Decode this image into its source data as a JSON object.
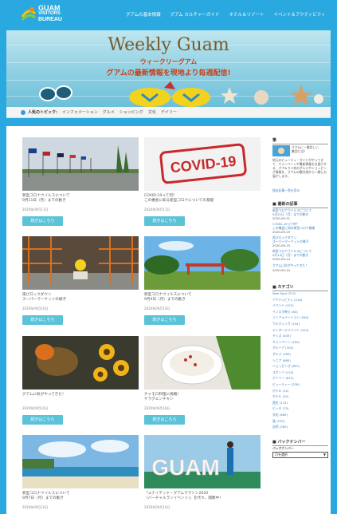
{
  "header": {
    "logo": {
      "line1": "GUAM",
      "line2": "VISITORS",
      "line3": "BUREAU"
    },
    "nav": [
      "グアムの基本情報",
      "グアム カルチャーガイド",
      "ホテル＆リゾート",
      "イベント＆アクティビティ"
    ]
  },
  "hero": {
    "title": "Weekly Guam",
    "subtitle1": "ウィークリーグアム",
    "subtitle2": "グアムの最新情報を現地より毎週配信!"
  },
  "topics": {
    "label": "人気のトピック:",
    "items": [
      "インフォメーション",
      "グルメ",
      "ショッピング",
      "文化",
      "デイリー"
    ]
  },
  "posts": [
    {
      "title": "新型コロナウイルスについて\n9月11日（月）までの動き",
      "date": "2020年09月11日",
      "button": "続きはこちら",
      "image": "flags-row"
    },
    {
      "title": "COVID-19って何？\nこの機会に知る新型コロナについての基礎",
      "date": "2020年09月11日",
      "button": "続きはこちら",
      "image": "covid-stamp"
    },
    {
      "title": "再びロックダウン\nスーパーマーケットの様子",
      "date": "2020年09月10日",
      "button": "続きはこちら",
      "image": "warehouse"
    },
    {
      "title": "新型コロナウイルスについて\n9月4日（月）までの動き",
      "date": "2020年09月10日",
      "button": "続きはこちら",
      "image": "park"
    },
    {
      "title": "グアムに秋がやってきた！",
      "date": "2020年09月10日",
      "button": "続きはこちら",
      "image": "autumn"
    },
    {
      "title": "チャモロ料理に挑戦！\nケラグエンチキン",
      "date": "2020年09月18日",
      "button": "続きはこちら",
      "image": "dish"
    },
    {
      "title": "新型コロナウイルスについて\n9月7日（月）までの動き",
      "date": "2020年09月10日",
      "button": "",
      "image": "beach"
    },
    {
      "title": "「ユナイテッド・グアムマラソン2020\n（バーチャルランイベント）」を代々、開催中！",
      "date": "2020年09月10日",
      "button": "",
      "image": "guam-letters"
    }
  ],
  "sidebar": {
    "profile_heading": "筆",
    "profile_name": "グアムに一番詳しい\n集団とは？",
    "profile_text": "地元のビューティ・ガイドがやってきて、キャンペーンや最新情報をお届けする、グアムで人気のグルメやショッピング情報を、グアムの観光地から一緒にお届けします。",
    "profile_link": "過去記事一覧を見る",
    "recent_heading": "最新の記事",
    "recent": [
      {
        "title": "新型コロナウイルスについて\n9月21日（月）までの動き",
        "date": "2020-09-21"
      },
      {
        "title": "COVID-19って何？\nこの機会に知る新型コロナ基礎",
        "date": "2020-09-19"
      },
      {
        "title": "再びロックダウン\nスーパーマーケットの様子",
        "date": "2020-09-15"
      },
      {
        "title": "新型コロナウイルスについて\n9月14日（月）までの動き",
        "date": "2020-09-14"
      },
      {
        "title": "グアムに秋がやってきた！",
        "date": "2020-09-10"
      }
    ],
    "category_heading": "カテゴリ",
    "categories": [
      "New Spot (212)",
      "アクティビティ (216)",
      "イベント (122)",
      "インスタ映え (84)",
      "インフォメーション (564)",
      "ウエディング (154)",
      "エンターテイメント (415)",
      "キッズ (400)",
      "キャンペーン (290)",
      "グループ (302)",
      "グルメ (789)",
      "シニア (680)",
      "ショッピング (897)",
      "スポーツ (123)",
      "デイリー (612)",
      "ビューティー (238)",
      "ホテル (12)",
      "ホテル (32)",
      "歴史 (115)",
      "ビーチ (75)",
      "文化 (685)",
      "島 (235)",
      "自然 (280)"
    ],
    "backnumber_heading": "バックナンバー",
    "backnumber_label": "バックナンバー",
    "backnumber_select": "月を選択"
  }
}
